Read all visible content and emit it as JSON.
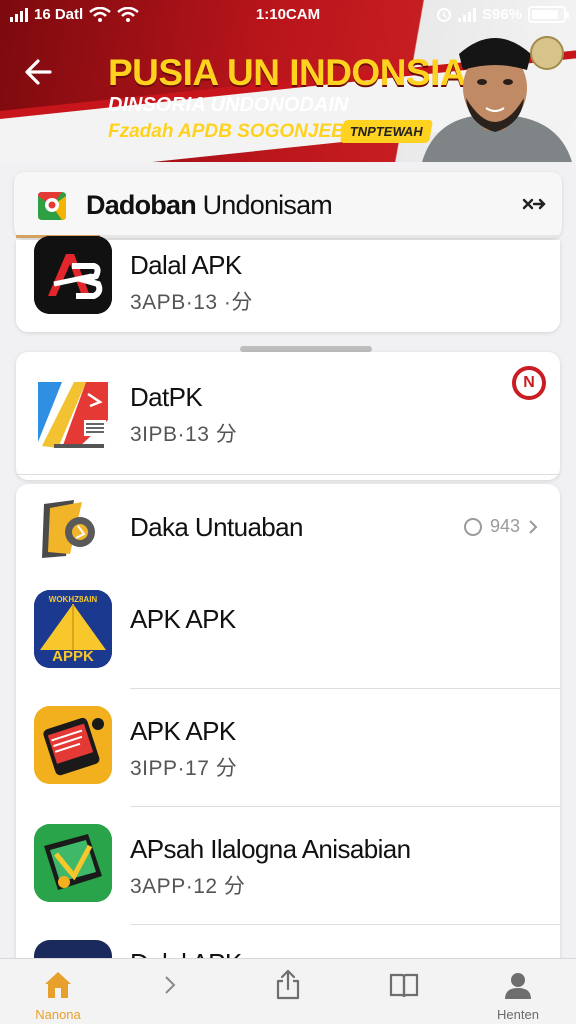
{
  "status_bar": {
    "left_text": "16 Datl",
    "time": "1:10CAM",
    "battery_text": "S96%",
    "battery_level": 0.85
  },
  "banner": {
    "title": "PUSIA UN INDONSIA",
    "subtitle": "DINSORIA UNDONODAIN",
    "tagline": "Fzadah APDB SOGONJEBIS",
    "badge": "TNPTEWAH"
  },
  "search": {
    "query_bold": "Dadoban",
    "query_rest": " Undonisam"
  },
  "apps": [
    {
      "name": "Dalal APK",
      "meta": "3APB·13 ·分"
    },
    {
      "name": "DatPK",
      "meta": "3IPB·13 分"
    },
    {
      "name": "Daka Untuaban",
      "meta": "",
      "extra": "943"
    },
    {
      "name": "APK APK",
      "meta": "",
      "icon_text_top": "WOKHZ8AIN",
      "icon_text_bottom": "APPK"
    },
    {
      "name": "APK APK",
      "meta": "3IPP·17 分"
    },
    {
      "name": "APsah Ilalogna Anisabian",
      "meta": "3APP·12 分"
    },
    {
      "name": "Dalal APK",
      "meta": ""
    }
  ],
  "bottom_nav": [
    {
      "label": "Nanona",
      "icon": "home-icon",
      "active": true
    },
    {
      "label": "",
      "icon": "chevron-right-icon"
    },
    {
      "label": "",
      "icon": "share-icon"
    },
    {
      "label": "",
      "icon": "book-icon"
    },
    {
      "label": "Henten",
      "icon": "profile-icon"
    }
  ],
  "colors": {
    "banner_red": "#b8151b",
    "banner_yellow": "#ffd21f",
    "accent_orange": "#e8a02c"
  }
}
